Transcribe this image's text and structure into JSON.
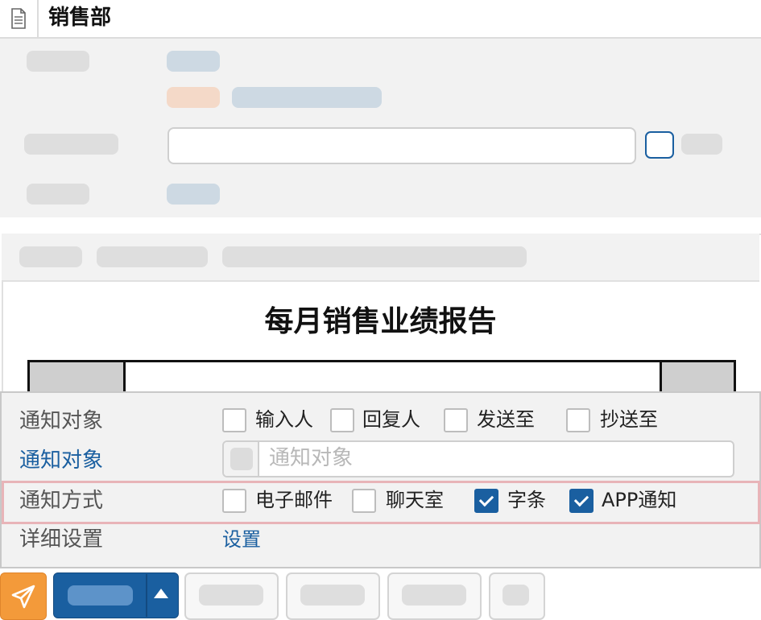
{
  "header": {
    "title": "销售部",
    "icon": "document-icon"
  },
  "report": {
    "title": "每月销售业绩报告"
  },
  "notify": {
    "targets_label": "通知对象",
    "targets": [
      {
        "label": "输入人",
        "checked": false
      },
      {
        "label": "回复人",
        "checked": false
      },
      {
        "label": "发送至",
        "checked": false
      },
      {
        "label": "抄送至",
        "checked": false
      }
    ],
    "target_picker_label": "通知对象",
    "target_picker_placeholder": "通知对象",
    "method_label": "通知方式",
    "methods": [
      {
        "label": "电子邮件",
        "checked": false
      },
      {
        "label": "聊天室",
        "checked": false
      },
      {
        "label": "字条",
        "checked": true
      },
      {
        "label": "APP通知",
        "checked": true
      }
    ],
    "detail_label": "详细设置",
    "detail_link": "设置"
  },
  "toolbar": {
    "send_icon": "send-icon",
    "dropdown_icon": "caret-up-icon"
  },
  "colors": {
    "accent": "#1a5fa0",
    "send": "#f39a3a",
    "highlight": "#e8b4b8"
  }
}
